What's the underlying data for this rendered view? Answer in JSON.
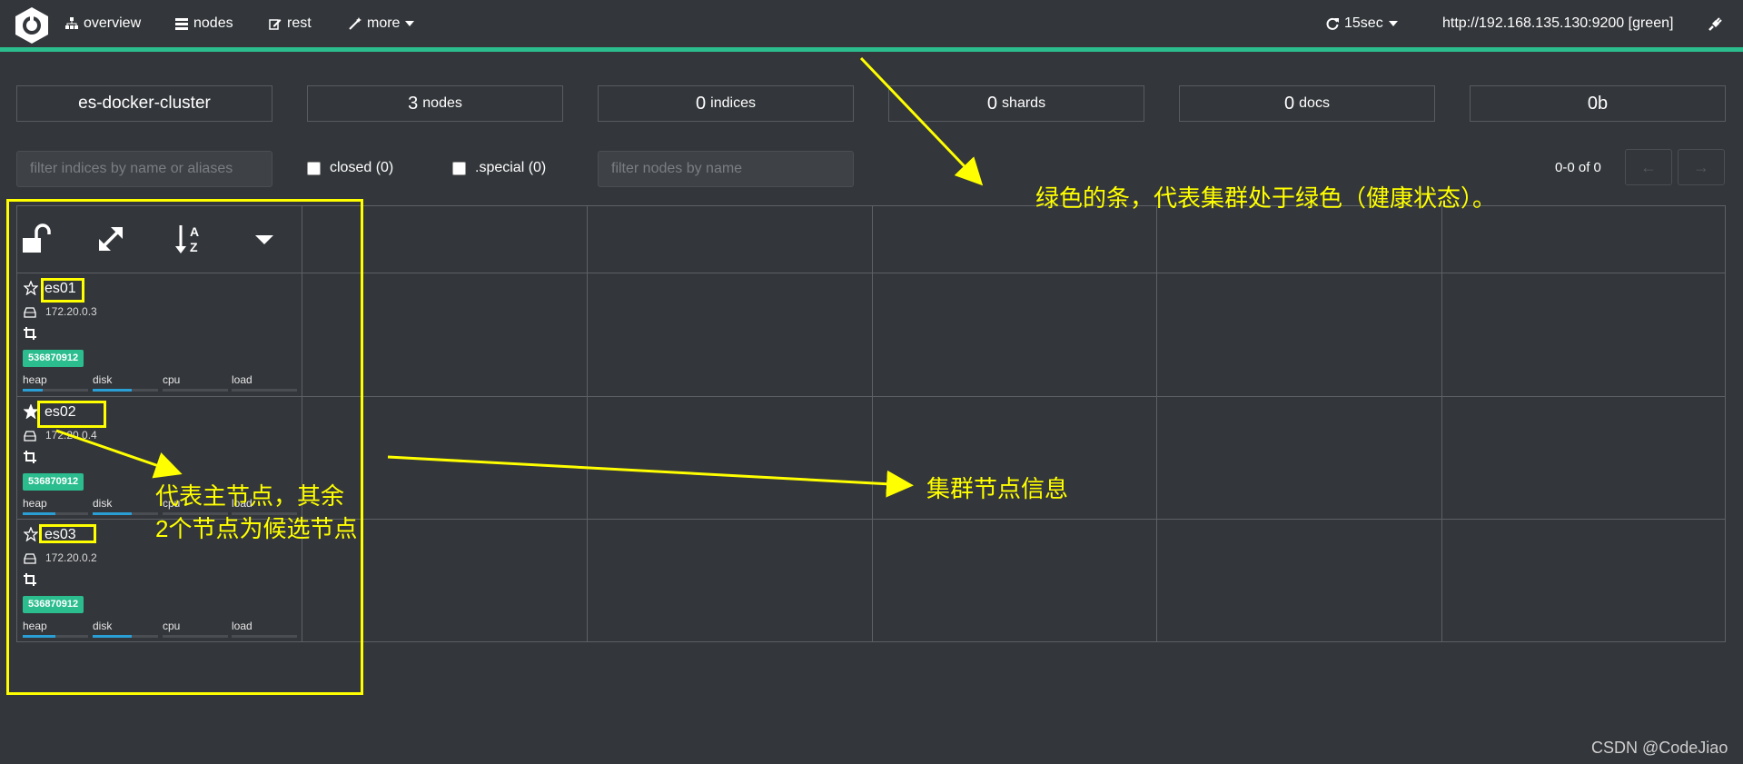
{
  "nav": {
    "overview": "overview",
    "nodes": "nodes",
    "rest": "rest",
    "more": "more",
    "refresh": "15sec",
    "cluster_url": "http://192.168.135.130:9200 [green]"
  },
  "status_color": "#2bbd8e",
  "stats": {
    "cluster_name": "es-docker-cluster",
    "nodes_num": "3",
    "nodes_lbl": "nodes",
    "indices_num": "0",
    "indices_lbl": "indices",
    "shards_num": "0",
    "shards_lbl": "shards",
    "docs_num": "0",
    "docs_lbl": "docs",
    "size": "0b"
  },
  "filters": {
    "indices_placeholder": "filter indices by name or aliases",
    "closed": "closed (0)",
    "special": ".special (0)",
    "nodes_placeholder": "filter nodes by name",
    "pager": "0-0 of 0",
    "prev": "←",
    "next": "→"
  },
  "toolbar_icons": [
    "unlock-icon",
    "expand-icon",
    "sort-alpha-icon",
    "caret-down-icon"
  ],
  "nodes": [
    {
      "name": "es01",
      "ip": "172.20.0.3",
      "id": "536870912",
      "master": false,
      "heap": "heap",
      "disk": "disk",
      "cpu": "cpu",
      "load": "load",
      "heap_pct": 0.3,
      "disk_pct": 0.6
    },
    {
      "name": "es02",
      "ip": "172.20.0.4",
      "id": "536870912",
      "master": true,
      "heap": "heap",
      "disk": "disk",
      "cpu": "cpu",
      "load": "load",
      "heap_pct": 0.5,
      "disk_pct": 0.6
    },
    {
      "name": "es03",
      "ip": "172.20.0.2",
      "id": "536870912",
      "master": false,
      "heap": "heap",
      "disk": "disk",
      "cpu": "cpu",
      "load": "load",
      "heap_pct": 0.5,
      "disk_pct": 0.6
    }
  ],
  "annotations": {
    "green_bar_note": "绿色的条，代表集群处于绿色（健康状态）。",
    "master_note_1": "代表主节点，其余",
    "master_note_2": "2个节点为候选节点",
    "nodes_info_note": "集群节点信息"
  },
  "watermark": "CSDN @CodeJiao"
}
